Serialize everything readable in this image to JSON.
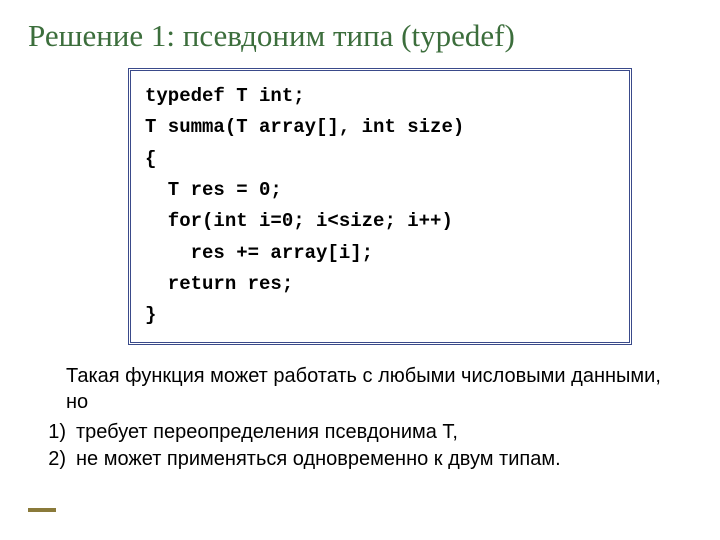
{
  "title": "Решение 1: псевдоним типа (typedef)",
  "code": {
    "l1": "typedef T int;",
    "l2": "T summa(T array[], int size)",
    "l3": "{",
    "l4": "  T res = 0;",
    "l5": "  for(int i=0; i<size; i++)",
    "l6": "    res += array[i];",
    "l7": "  return res;",
    "l8": "}"
  },
  "paragraph": "Такая функция может работать с любыми числовыми данными, но",
  "list": {
    "n1": "1)",
    "t1": "требует переопределения псевдонима T,",
    "n2": "2)",
    "t2": " не может применяться одновременно к двум типам."
  }
}
